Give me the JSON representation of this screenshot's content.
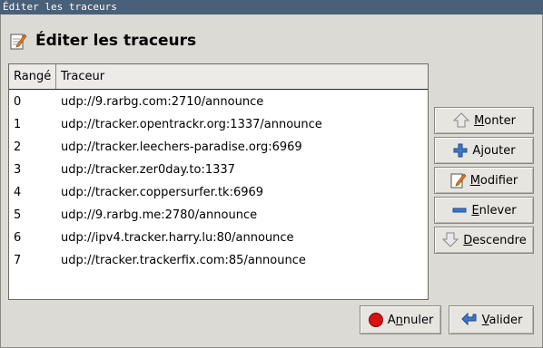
{
  "window": {
    "title": "Éditer les traceurs"
  },
  "header": {
    "title": "Éditer les traceurs"
  },
  "table": {
    "columns": [
      "Rangé",
      "Traceur"
    ],
    "rows": [
      {
        "rank": "0",
        "tracker": "udp://9.rarbg.com:2710/announce"
      },
      {
        "rank": "1",
        "tracker": "udp://tracker.opentrackr.org:1337/announce"
      },
      {
        "rank": "2",
        "tracker": "udp://tracker.leechers-paradise.org:6969"
      },
      {
        "rank": "3",
        "tracker": "udp://tracker.zer0day.to:1337"
      },
      {
        "rank": "4",
        "tracker": "udp://tracker.coppersurfer.tk:6969"
      },
      {
        "rank": "5",
        "tracker": "udp://9.rarbg.me:2780/announce"
      },
      {
        "rank": "6",
        "tracker": "udp://ipv4.tracker.harry.lu:80/announce"
      },
      {
        "rank": "7",
        "tracker": "udp://tracker.trackerfix.com:85/announce"
      }
    ]
  },
  "buttons": {
    "up": {
      "mn": "M",
      "rest": "onter",
      "icon": "arrow-up-icon"
    },
    "add": {
      "pre": "A",
      "mn": "j",
      "rest": "outer",
      "icon": "plus-icon"
    },
    "edit": {
      "pre": "",
      "mn": "M",
      "rest": "odifier",
      "icon": "edit-icon"
    },
    "remove": {
      "mn": "E",
      "rest": "nlever",
      "icon": "minus-icon"
    },
    "down": {
      "mn": "D",
      "rest": "escendre",
      "icon": "arrow-down-icon"
    },
    "cancel": {
      "pre": "A",
      "mn": "n",
      "rest": "nuler",
      "icon": "cancel-icon"
    },
    "ok": {
      "mn": "V",
      "rest": "alider",
      "icon": "back-arrow-icon"
    }
  }
}
